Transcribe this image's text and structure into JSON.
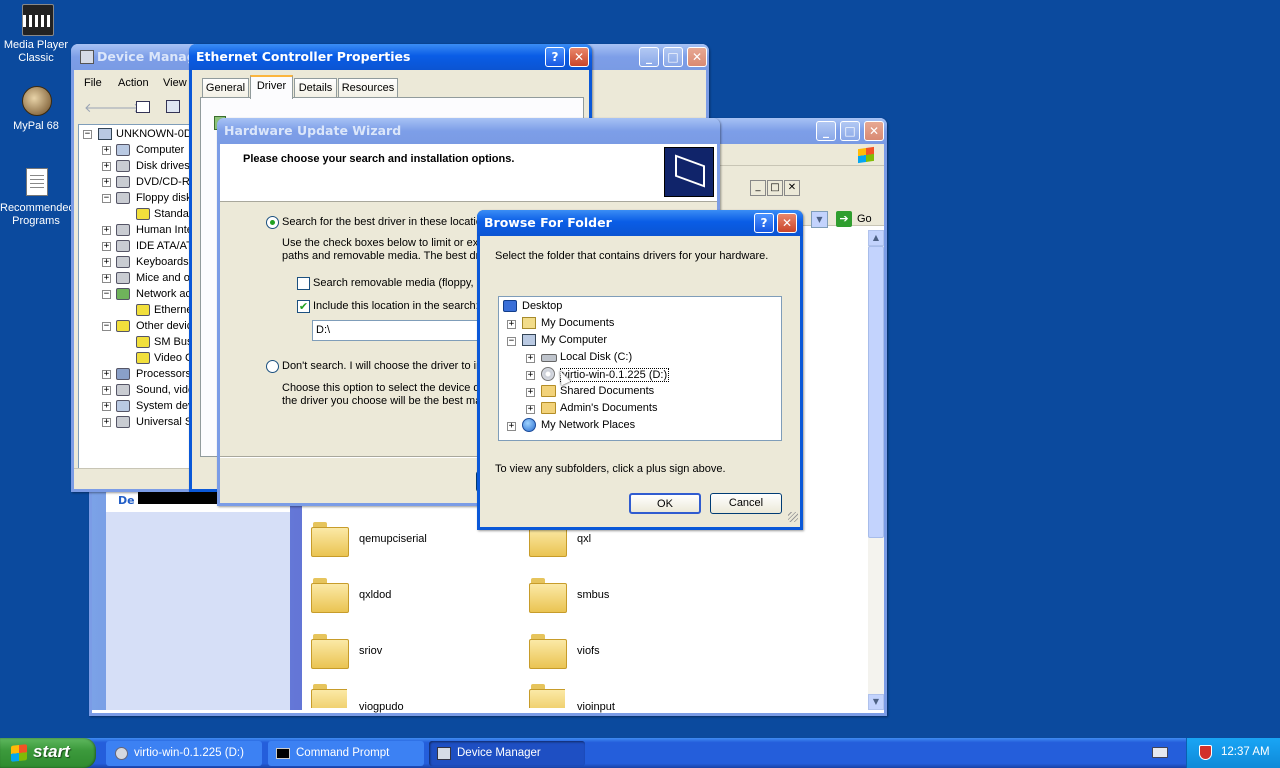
{
  "desktop": {
    "icons": [
      {
        "label": "Media Player Classic",
        "icon": "media-player-icon"
      },
      {
        "label": "MyPal 68",
        "icon": "mypal-browser-icon"
      },
      {
        "label": "Recommended Programs",
        "icon": "document-icon"
      }
    ]
  },
  "device_manager": {
    "title": "Device Manager",
    "menu": [
      "File",
      "Action",
      "View"
    ],
    "tree_root": "UNKNOWN-0D1",
    "tree": [
      "Computer",
      "Disk drives",
      "DVD/CD-RO",
      "Floppy disk",
      "Standa",
      "Human Inte",
      "IDE ATA/AT",
      "Keyboards",
      "Mice and ot",
      "Network ac",
      "Etherne",
      "Other devic",
      "SM Bus",
      "Video C",
      "Processors",
      "Sound, vide",
      "System dev",
      "Universal S"
    ]
  },
  "ethernet_props": {
    "title": "Ethernet Controller Properties",
    "tabs": [
      "General",
      "Driver",
      "Details",
      "Resources"
    ],
    "active_tab": "Driver"
  },
  "explorer": {
    "go_label": "Go",
    "left_label": "De",
    "folders": [
      "qemupciserial",
      "qxl",
      "qxldod",
      "smbus",
      "sriov",
      "viofs",
      "viogpudo",
      "vioinput"
    ]
  },
  "wizard": {
    "title": "Hardware Update Wizard",
    "heading": "Please choose your search and installation options.",
    "option_search": "Search for the best driver in these location",
    "option_search_desc_1": "Use the check boxes below to limit or exp",
    "option_search_desc_2": "paths and removable media. The best driv",
    "check_removable": "Search removable media (floppy, CD",
    "check_include": "Include this location in the search:",
    "location_value": "D:\\",
    "option_dont_search": "Don't search. I will choose the driver to ins",
    "option_dont_desc_1": "Choose this option to select the device dri",
    "option_dont_desc_2": "the driver you choose will be the best mat"
  },
  "browse": {
    "title": "Browse For Folder",
    "instruction": "Select the folder that contains drivers for your hardware.",
    "tree": {
      "desktop": "Desktop",
      "my_documents": "My Documents",
      "my_computer": "My Computer",
      "local_disk": "Local Disk (C:)",
      "virtio": "virtio-win-0.1.225 (D:)",
      "shared_docs": "Shared Documents",
      "admin_docs": "Admin's Documents",
      "network": "My Network Places"
    },
    "hint": "To view any subfolders, click a plus sign above.",
    "ok": "OK",
    "cancel": "Cancel"
  },
  "taskbar": {
    "start": "start",
    "tasks": [
      "virtio-win-0.1.225 (D:)",
      "Command Prompt",
      "Device Manager"
    ],
    "clock": "12:37 AM"
  }
}
